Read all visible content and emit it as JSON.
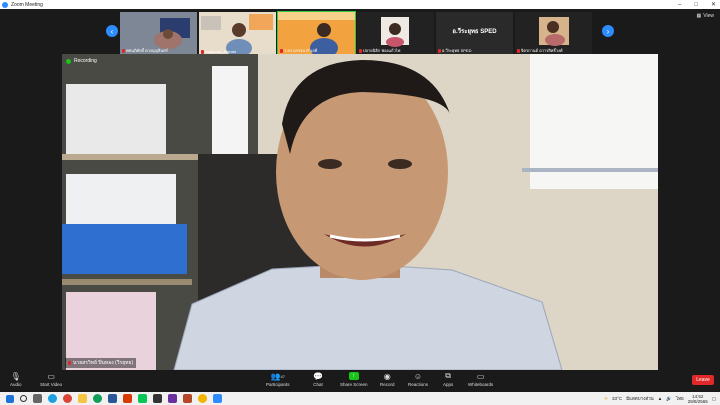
{
  "window": {
    "title": "Zoom Meeting"
  },
  "stage": {
    "view_label": "View"
  },
  "thumbnails": [
    {
      "name": "ศศนภิศักดิ์ ดวงบุญสินทร์",
      "muted": true
    },
    {
      "name": "Nagamal_Ahmad",
      "muted": true
    },
    {
      "name": "ว.ดร.บรรจบ ทำเลดี",
      "muted": true
    },
    {
      "name": "ปลายนิธิก ฟองแก้วไพ",
      "muted": true
    },
    {
      "name": "อ.วีระยุทธ SPED",
      "muted": true,
      "avatar_text": "อ.วีระยุทธ SPED"
    },
    {
      "name": "จิตรกานต์ อวารสิทธิ์วงศ์",
      "muted": true
    }
  ],
  "main_video": {
    "recording_label": "Recording",
    "speaker_name": "นายสรวิทย์ ปิ่นทอง (วีรยุทธ)"
  },
  "toolbar": {
    "audio": "Audio",
    "start_video": "Start Video",
    "participants": "Participants",
    "participants_count": "47",
    "chat": "Chat",
    "share_screen": "Share Screen",
    "record": "Record",
    "reactions": "Reactions",
    "apps": "Apps",
    "whiteboards": "Whiteboards",
    "leave": "Leave"
  },
  "taskbar": {
    "weather": "33°C",
    "weather_desc": "มีแดดบางส่วน",
    "lang": "ไทย",
    "time": "14:52",
    "date": "28/8/2565"
  }
}
